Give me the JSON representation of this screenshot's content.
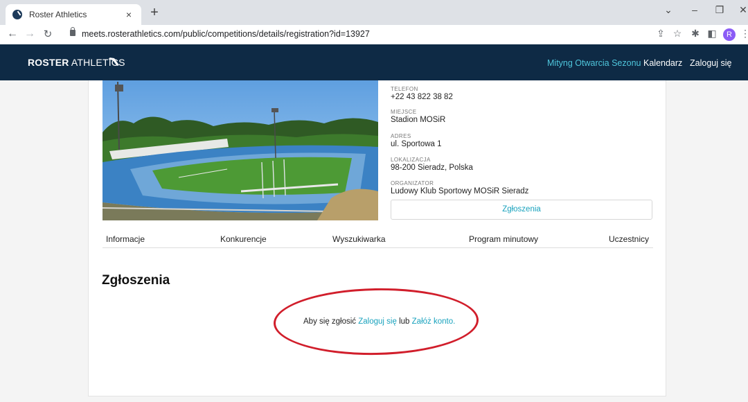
{
  "browser": {
    "tab_title": "Roster Athletics",
    "tab_close": "×",
    "new_tab": "+",
    "url": "meets.rosterathletics.com/public/competitions/details/registration?id=13927",
    "profile_initial": "R"
  },
  "header": {
    "logo_bold": "ROSTER",
    "logo_light": "ATHLETICS",
    "nav": [
      {
        "label": "Mityng Otwarcia Sezonu"
      },
      {
        "label": "Kalendarz"
      },
      {
        "label": "Zaloguj się"
      }
    ],
    "accent_color": "#4fc6dc",
    "background_color": "#0e2a45"
  },
  "details": {
    "phone_label": "TELEFON",
    "phone": "+22 43 822 38 82",
    "place_label": "MIEJSCE",
    "place": "Stadion MOSiR",
    "address_label": "ADRES",
    "address": "ul. Sportowa 1",
    "location_label": "LOKALIZACJA",
    "location": "98-200 Sieradz, Polska",
    "organizer_label": "ORGANIZATOR",
    "organizer": "Ludowy Klub Sportowy MOSiR Sieradz",
    "registration_button": "Zgłoszenia"
  },
  "tabs": [
    {
      "label": "Informacje"
    },
    {
      "label": "Konkurencje"
    },
    {
      "label": "Wyszukiwarka"
    },
    {
      "label": "Program minutowy"
    },
    {
      "label": "Uczestnicy"
    }
  ],
  "registration": {
    "title": "Zgłoszenia",
    "message_prefix": "Aby się zgłosić",
    "login_link": "Zaloguj się",
    "or_text": "lub",
    "create_account_link": "Załóż konto",
    "message_suffix": ".",
    "link_color": "#18a2bd",
    "annotation_color": "#d11e2b"
  }
}
